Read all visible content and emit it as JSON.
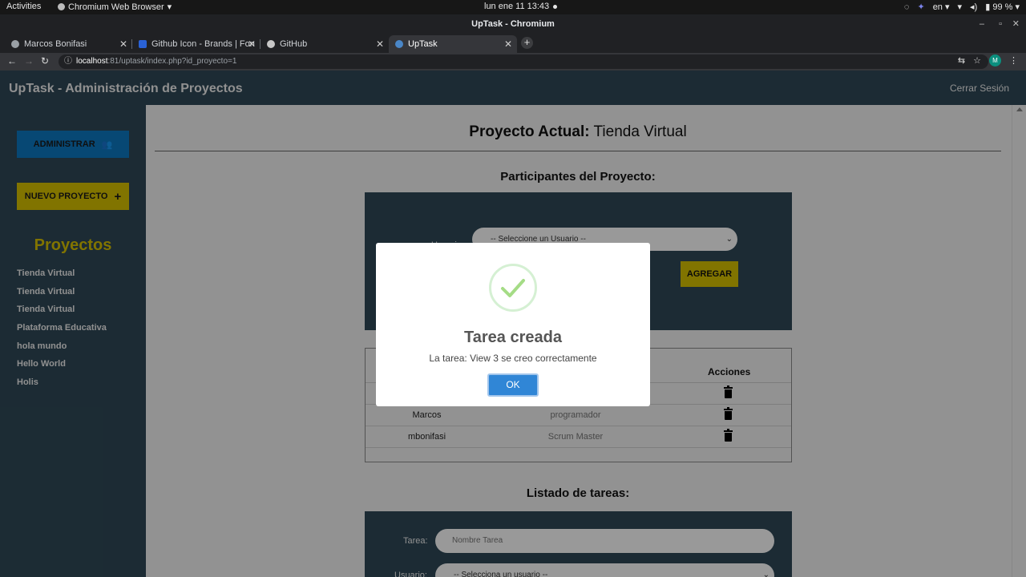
{
  "system_bar": {
    "activities": "Activities",
    "app_name": "Chromium Web Browser",
    "clock": "lun ene 11  13:43",
    "language": "en",
    "battery": "99 %"
  },
  "window": {
    "title": "UpTask - Chromium"
  },
  "tabs": [
    {
      "label": "Marcos Bonifasi",
      "active": false
    },
    {
      "label": "Github Icon - Brands | Fon",
      "active": false
    },
    {
      "label": "GitHub",
      "active": false
    },
    {
      "label": "UpTask",
      "active": true
    }
  ],
  "address_bar": {
    "host": "localhost",
    "rest": ":81/uptask/index.php?id_proyecto=1"
  },
  "profile_initial": "M",
  "app": {
    "title": "UpTask - Administración de Proyectos",
    "logout": "Cerrar Sesión"
  },
  "sidebar": {
    "admin_button": "ADMINISTRAR",
    "new_project_button": "NUEVO PROYECTO",
    "projects_title": "Proyectos",
    "projects": [
      "Tienda Virtual",
      "Tienda Virtual",
      "Tienda Virtual",
      "Plataforma Educativa",
      "hola mundo",
      "Hello World",
      "Holis"
    ]
  },
  "main": {
    "current_label": "Proyecto Actual:",
    "current_project": "Tienda Virtual",
    "participants_title": "Participantes del Proyecto:",
    "user_label": "Usuario:",
    "user_select_value": "-- Seleccione un Usuario --",
    "add_button": "AGREGAR",
    "table_header_actions": "Acciones",
    "participants": [
      {
        "name": "Marcos",
        "role": "programador"
      },
      {
        "name": "mbonifasi",
        "role": "Scrum Master"
      }
    ],
    "tasks_title": "Listado de tareas:",
    "task_label": "Tarea:",
    "task_placeholder": "Nombre Tarea",
    "task_user_label": "Usuario:",
    "task_user_value": "-- Selecciona un usuario --"
  },
  "modal": {
    "title": "Tarea creada",
    "text": "La tarea: View 3 se creo correctamente",
    "ok": "OK"
  },
  "colors": {
    "brand_dark": "#2f4957",
    "accent_yellow": "#d7c100",
    "accent_blue": "#0c78c2",
    "ok_blue": "#3086d6",
    "success_green": "#a5dc86"
  }
}
